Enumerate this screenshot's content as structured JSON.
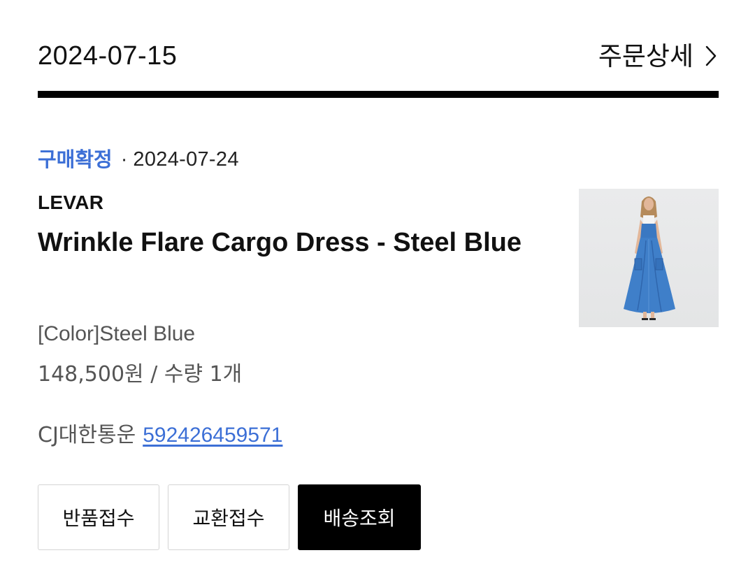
{
  "order": {
    "date": "2024-07-15",
    "detail_label": "주문상세",
    "detail_icon": "chevron-right-icon"
  },
  "item": {
    "status": "구매확정",
    "separator": "·",
    "status_date": "2024-07-24",
    "brand": "LEVAR",
    "name": "Wrinkle Flare Cargo Dress - Steel Blue",
    "option": "[Color]Steel Blue",
    "price_qty": "148,500원 / 수량 1개",
    "carrier": "CJ대한통운",
    "tracking_number": "592426459571",
    "thumbnail": "product-photo-blue-cargo-dress"
  },
  "actions": {
    "return_label": "반품접수",
    "exchange_label": "교환접수",
    "track_label": "배송조회"
  },
  "colors": {
    "status_blue": "#3c6fd6",
    "divider": "#000000",
    "primary_button_bg": "#000000",
    "secondary_text": "#555555"
  }
}
